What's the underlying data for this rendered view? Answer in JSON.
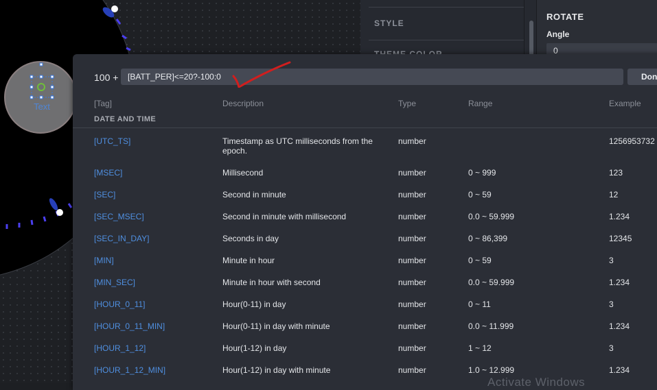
{
  "inspector": {
    "style_label": "STYLE",
    "theme_label": "THEME COLOR",
    "rotate_label": "ROTATE",
    "angle_label": "Angle",
    "angle_value": "0"
  },
  "canvas": {
    "text_widget_label": "Text"
  },
  "modal": {
    "expression_prefix": "100 +",
    "expression_value": "[BATT_PER]<=20?-100:0",
    "done_label": "Done",
    "columns": {
      "tag": "[Tag]",
      "description": "Description",
      "type": "Type",
      "range": "Range",
      "example": "Example"
    },
    "section_title": "DATE AND TIME",
    "rows": [
      {
        "tag": "[UTC_TS]",
        "description": "Timestamp as UTC milliseconds from the epoch.",
        "type": "number",
        "range": "",
        "example": "1256953732"
      },
      {
        "tag": "[MSEC]",
        "description": "Millisecond",
        "type": "number",
        "range": "0 ~ 999",
        "example": "123"
      },
      {
        "tag": "[SEC]",
        "description": "Second in minute",
        "type": "number",
        "range": "0 ~ 59",
        "example": "12"
      },
      {
        "tag": "[SEC_MSEC]",
        "description": "Second in minute with millisecond",
        "type": "number",
        "range": "0.0 ~ 59.999",
        "example": "1.234"
      },
      {
        "tag": "[SEC_IN_DAY]",
        "description": "Seconds in day",
        "type": "number",
        "range": "0 ~ 86,399",
        "example": "12345"
      },
      {
        "tag": "[MIN]",
        "description": "Minute in hour",
        "type": "number",
        "range": "0 ~ 59",
        "example": "3"
      },
      {
        "tag": "[MIN_SEC]",
        "description": "Minute in hour with second",
        "type": "number",
        "range": "0.0 ~ 59.999",
        "example": "1.234"
      },
      {
        "tag": "[HOUR_0_11]",
        "description": "Hour(0-11) in day",
        "type": "number",
        "range": "0 ~ 11",
        "example": "3"
      },
      {
        "tag": "[HOUR_0_11_MIN]",
        "description": "Hour(0-11) in day with minute",
        "type": "number",
        "range": "0.0 ~ 11.999",
        "example": "1.234"
      },
      {
        "tag": "[HOUR_1_12]",
        "description": "Hour(1-12) in day",
        "type": "number",
        "range": "1 ~ 12",
        "example": "3"
      },
      {
        "tag": "[HOUR_1_12_MIN]",
        "description": "Hour(1-12) in day with minute",
        "type": "number",
        "range": "1.0 ~ 12.999",
        "example": "1.234"
      }
    ]
  },
  "os_watermark": "Activate Windows",
  "colors": {
    "tag_link": "#4f8fe0",
    "accent_tick": "#4b3ff0",
    "annotation_red": "#d11e1e"
  }
}
